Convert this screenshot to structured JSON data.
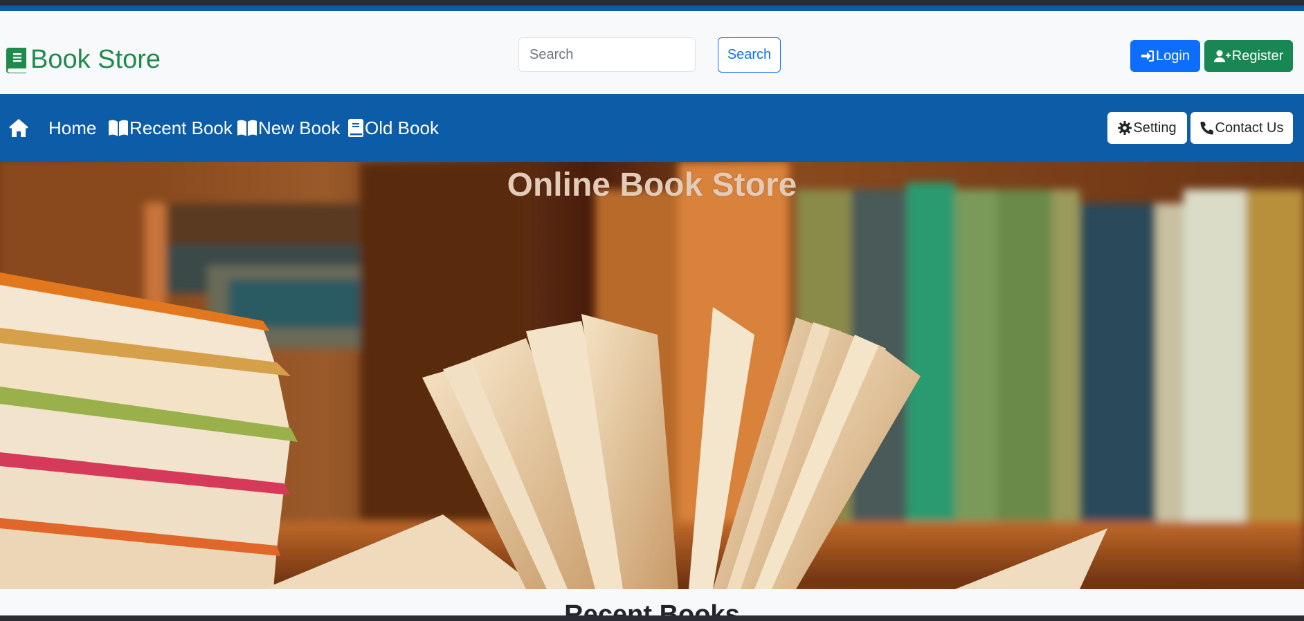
{
  "brand": {
    "name": "Book Store",
    "icon": "book-icon",
    "color": "#1f8a4c"
  },
  "search": {
    "placeholder": "Search",
    "value": "",
    "button_label": "Search"
  },
  "auth": {
    "login_label": "Login",
    "register_label": "Register"
  },
  "nav": {
    "items": [
      {
        "label": "Home",
        "icon": "home-icon"
      },
      {
        "label": "Recent Book",
        "icon": "open-book-icon"
      },
      {
        "label": "New Book",
        "icon": "open-book-icon"
      },
      {
        "label": "Old Book",
        "icon": "book-icon"
      }
    ],
    "setting_label": "Setting",
    "contact_label": "Contact Us",
    "color": "#0d5ca8"
  },
  "hero": {
    "title": "Online Book Store"
  },
  "section": {
    "recent_title": "Recent Books"
  },
  "colors": {
    "primary": "#0d6efd",
    "success": "#198754",
    "nav": "#0d5ca8"
  }
}
